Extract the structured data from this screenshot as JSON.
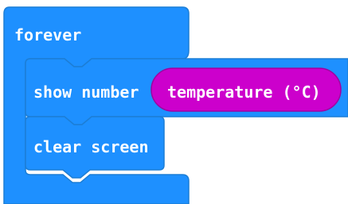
{
  "workspace": {
    "colors": {
      "basic_block": "#1E90FF",
      "basic_block_border": "#1C7ED6",
      "input_block": "#CC00CC",
      "input_block_border": "#A000A0",
      "text": "#ffffff"
    },
    "blocks": {
      "forever": {
        "label": "forever"
      },
      "show_number": {
        "label": "show number",
        "input": {
          "label": "temperature (°C)"
        }
      },
      "clear_screen": {
        "label": "clear screen"
      }
    },
    "icons": [
      "block-notch-icon"
    ]
  }
}
